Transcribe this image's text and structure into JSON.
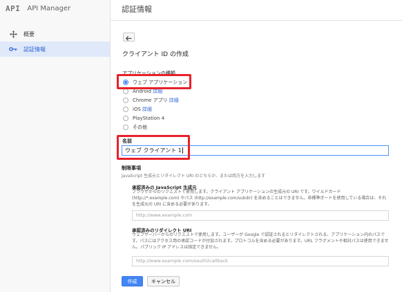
{
  "app": {
    "logo": "API",
    "name": "API Manager"
  },
  "sidebar": {
    "items": [
      {
        "label": "概要",
        "icon": "move-arrows-icon"
      },
      {
        "label": "認証情報",
        "icon": "key-icon",
        "active": true
      }
    ]
  },
  "header": {
    "title": "認証情報"
  },
  "form": {
    "back_icon": "back-arrow-icon",
    "title": "クライアント ID の作成",
    "app_type": {
      "label": "アプリケーションの種類",
      "options": [
        {
          "label": "ウェブ アプリケーション",
          "selected": true
        },
        {
          "label": "Android",
          "link": "詳細"
        },
        {
          "label": "Chrome アプリ",
          "link": "詳細"
        },
        {
          "label": "iOS",
          "link": "詳細"
        },
        {
          "label": "PlayStation 4"
        },
        {
          "label": "その他"
        }
      ]
    },
    "name": {
      "label": "名前",
      "value": "ウェブ クライアント 1"
    },
    "restrictions": {
      "title": "制限事項",
      "help": "JavaScript 生成元とリダイレクト URI のどちらか、または両方を入力します",
      "js_origins": {
        "title": "承認済みの JavaScript 生成元",
        "description": "ブラウザからのリクエストで使用します。クライアント アプリケーションの生成元の URI です。ワイルドカード (http://*.example.com) やパス (http://example.com/subdir) を含めることはできません。非標準ポートを使用している場合は、それを生成元の URI に含める必要があります。",
        "placeholder": "http://www.example.com"
      },
      "redirect_uris": {
        "title": "承認済みのリダイレクト URI",
        "description": "ウェブサーバーからのリクエストで使用します。ユーザーが Google で認証されるとリダイレクトされる、アプリケーション内のパスです。パスにはアクセス用の承認コードが付加されます。プロトコルを含める必要があります。URL フラグメントや相対パスは使用できません。パブリック IP アドレスは指定できません。",
        "placeholder": "http://www.example.com/oauth2callback"
      }
    },
    "buttons": {
      "create": "作成",
      "cancel": "キャンセル"
    }
  },
  "annotation_color": "#e8202a"
}
